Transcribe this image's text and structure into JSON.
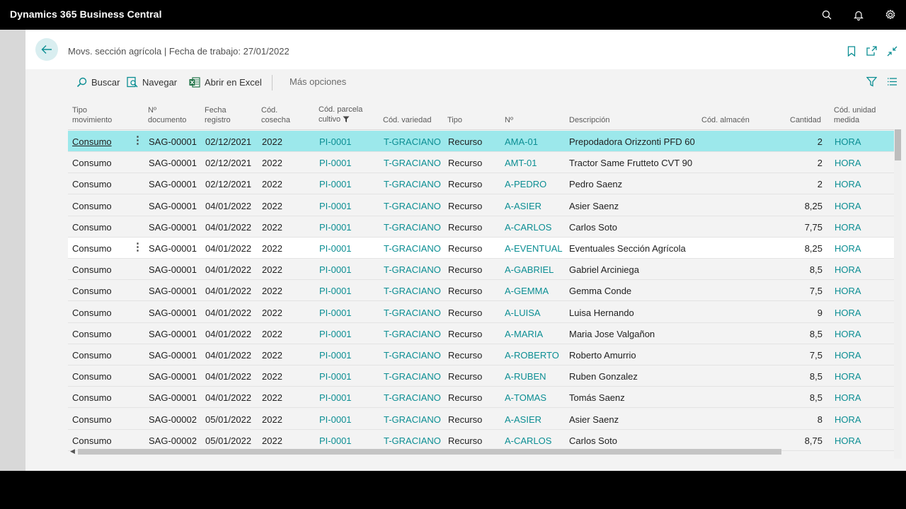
{
  "app": {
    "title": "Dynamics 365 Business Central"
  },
  "page": {
    "title": "Movs. sección agrícola | Fecha de trabajo: 27/01/2022"
  },
  "actions": {
    "search": "Buscar",
    "navigate": "Navegar",
    "excel": "Abrir en Excel",
    "more": "Más opciones"
  },
  "columns": [
    {
      "key": "tipo_mov",
      "l1": "Tipo",
      "l2": "movimiento"
    },
    {
      "key": "doc",
      "l1": "Nº",
      "l2": "documento"
    },
    {
      "key": "fecha",
      "l1": "Fecha",
      "l2": "registro"
    },
    {
      "key": "cosecha",
      "l1": "Cód.",
      "l2": "cosecha"
    },
    {
      "key": "parcela",
      "l1": "Cód. parcela",
      "l2": "cultivo"
    },
    {
      "key": "variedad",
      "l1": "",
      "l2": "Cód. variedad"
    },
    {
      "key": "tipo",
      "l1": "",
      "l2": "Tipo"
    },
    {
      "key": "no",
      "l1": "",
      "l2": "Nº"
    },
    {
      "key": "descripcion",
      "l1": "",
      "l2": "Descripción"
    },
    {
      "key": "almacen",
      "l1": "",
      "l2": "Cód. almacén"
    },
    {
      "key": "cantidad",
      "l1": "",
      "l2": "Cantidad"
    },
    {
      "key": "unidad",
      "l1": "Cód. unidad",
      "l2": "medida"
    }
  ],
  "rows": [
    {
      "tipo_mov": "Consumo",
      "doc": "SAG-00001",
      "fecha": "02/12/2021",
      "cosecha": "2022",
      "parcela": "PI-0001",
      "variedad": "T-GRACIANO",
      "tipo": "Recurso",
      "no": "AMA-01",
      "descripcion": "Prepodadora Orizzonti PFD 60",
      "almacen": "",
      "cantidad": "2",
      "unidad": "HORA"
    },
    {
      "tipo_mov": "Consumo",
      "doc": "SAG-00001",
      "fecha": "02/12/2021",
      "cosecha": "2022",
      "parcela": "PI-0001",
      "variedad": "T-GRACIANO",
      "tipo": "Recurso",
      "no": "AMT-01",
      "descripcion": "Tractor Same Frutteto CVT 90",
      "almacen": "",
      "cantidad": "2",
      "unidad": "HORA"
    },
    {
      "tipo_mov": "Consumo",
      "doc": "SAG-00001",
      "fecha": "02/12/2021",
      "cosecha": "2022",
      "parcela": "PI-0001",
      "variedad": "T-GRACIANO",
      "tipo": "Recurso",
      "no": "A-PEDRO",
      "descripcion": "Pedro Saenz",
      "almacen": "",
      "cantidad": "2",
      "unidad": "HORA"
    },
    {
      "tipo_mov": "Consumo",
      "doc": "SAG-00001",
      "fecha": "04/01/2022",
      "cosecha": "2022",
      "parcela": "PI-0001",
      "variedad": "T-GRACIANO",
      "tipo": "Recurso",
      "no": "A-ASIER",
      "descripcion": "Asier Saenz",
      "almacen": "",
      "cantidad": "8,25",
      "unidad": "HORA"
    },
    {
      "tipo_mov": "Consumo",
      "doc": "SAG-00001",
      "fecha": "04/01/2022",
      "cosecha": "2022",
      "parcela": "PI-0001",
      "variedad": "T-GRACIANO",
      "tipo": "Recurso",
      "no": "A-CARLOS",
      "descripcion": "Carlos Soto",
      "almacen": "",
      "cantidad": "7,75",
      "unidad": "HORA"
    },
    {
      "tipo_mov": "Consumo",
      "doc": "SAG-00001",
      "fecha": "04/01/2022",
      "cosecha": "2022",
      "parcela": "PI-0001",
      "variedad": "T-GRACIANO",
      "tipo": "Recurso",
      "no": "A-EVENTUAL",
      "descripcion": "Eventuales Sección Agrícola",
      "almacen": "",
      "cantidad": "8,25",
      "unidad": "HORA"
    },
    {
      "tipo_mov": "Consumo",
      "doc": "SAG-00001",
      "fecha": "04/01/2022",
      "cosecha": "2022",
      "parcela": "PI-0001",
      "variedad": "T-GRACIANO",
      "tipo": "Recurso",
      "no": "A-GABRIEL",
      "descripcion": "Gabriel Arciniega",
      "almacen": "",
      "cantidad": "8,5",
      "unidad": "HORA"
    },
    {
      "tipo_mov": "Consumo",
      "doc": "SAG-00001",
      "fecha": "04/01/2022",
      "cosecha": "2022",
      "parcela": "PI-0001",
      "variedad": "T-GRACIANO",
      "tipo": "Recurso",
      "no": "A-GEMMA",
      "descripcion": "Gemma Conde",
      "almacen": "",
      "cantidad": "7,5",
      "unidad": "HORA"
    },
    {
      "tipo_mov": "Consumo",
      "doc": "SAG-00001",
      "fecha": "04/01/2022",
      "cosecha": "2022",
      "parcela": "PI-0001",
      "variedad": "T-GRACIANO",
      "tipo": "Recurso",
      "no": "A-LUISA",
      "descripcion": "Luisa Hernando",
      "almacen": "",
      "cantidad": "9",
      "unidad": "HORA"
    },
    {
      "tipo_mov": "Consumo",
      "doc": "SAG-00001",
      "fecha": "04/01/2022",
      "cosecha": "2022",
      "parcela": "PI-0001",
      "variedad": "T-GRACIANO",
      "tipo": "Recurso",
      "no": "A-MARIA",
      "descripcion": "Maria Jose Valgañon",
      "almacen": "",
      "cantidad": "8,5",
      "unidad": "HORA"
    },
    {
      "tipo_mov": "Consumo",
      "doc": "SAG-00001",
      "fecha": "04/01/2022",
      "cosecha": "2022",
      "parcela": "PI-0001",
      "variedad": "T-GRACIANO",
      "tipo": "Recurso",
      "no": "A-ROBERTO",
      "descripcion": "Roberto Amurrio",
      "almacen": "",
      "cantidad": "7,5",
      "unidad": "HORA"
    },
    {
      "tipo_mov": "Consumo",
      "doc": "SAG-00001",
      "fecha": "04/01/2022",
      "cosecha": "2022",
      "parcela": "PI-0001",
      "variedad": "T-GRACIANO",
      "tipo": "Recurso",
      "no": "A-RUBEN",
      "descripcion": "Ruben Gonzalez",
      "almacen": "",
      "cantidad": "8,5",
      "unidad": "HORA"
    },
    {
      "tipo_mov": "Consumo",
      "doc": "SAG-00001",
      "fecha": "04/01/2022",
      "cosecha": "2022",
      "parcela": "PI-0001",
      "variedad": "T-GRACIANO",
      "tipo": "Recurso",
      "no": "A-TOMAS",
      "descripcion": "Tomás Saenz",
      "almacen": "",
      "cantidad": "8,5",
      "unidad": "HORA"
    },
    {
      "tipo_mov": "Consumo",
      "doc": "SAG-00002",
      "fecha": "05/01/2022",
      "cosecha": "2022",
      "parcela": "PI-0001",
      "variedad": "T-GRACIANO",
      "tipo": "Recurso",
      "no": "A-ASIER",
      "descripcion": "Asier Saenz",
      "almacen": "",
      "cantidad": "8",
      "unidad": "HORA"
    },
    {
      "tipo_mov": "Consumo",
      "doc": "SAG-00002",
      "fecha": "05/01/2022",
      "cosecha": "2022",
      "parcela": "PI-0001",
      "variedad": "T-GRACIANO",
      "tipo": "Recurso",
      "no": "A-CARLOS",
      "descripcion": "Carlos Soto",
      "almacen": "",
      "cantidad": "8,75",
      "unidad": "HORA"
    }
  ],
  "icons": {
    "search": "search-icon",
    "bell": "bell-icon",
    "settings": "gear-icon",
    "back": "arrow-left-icon",
    "bookmark": "bookmark-icon",
    "popout": "popout-icon",
    "collapse": "collapse-icon",
    "filter": "filter-icon",
    "list": "list-icon",
    "excel": "excel-icon",
    "navigate": "navigate-icon"
  },
  "colors": {
    "accent": "#0b8e93",
    "selected_row": "#9ce8eb",
    "topbar": "#000000"
  }
}
